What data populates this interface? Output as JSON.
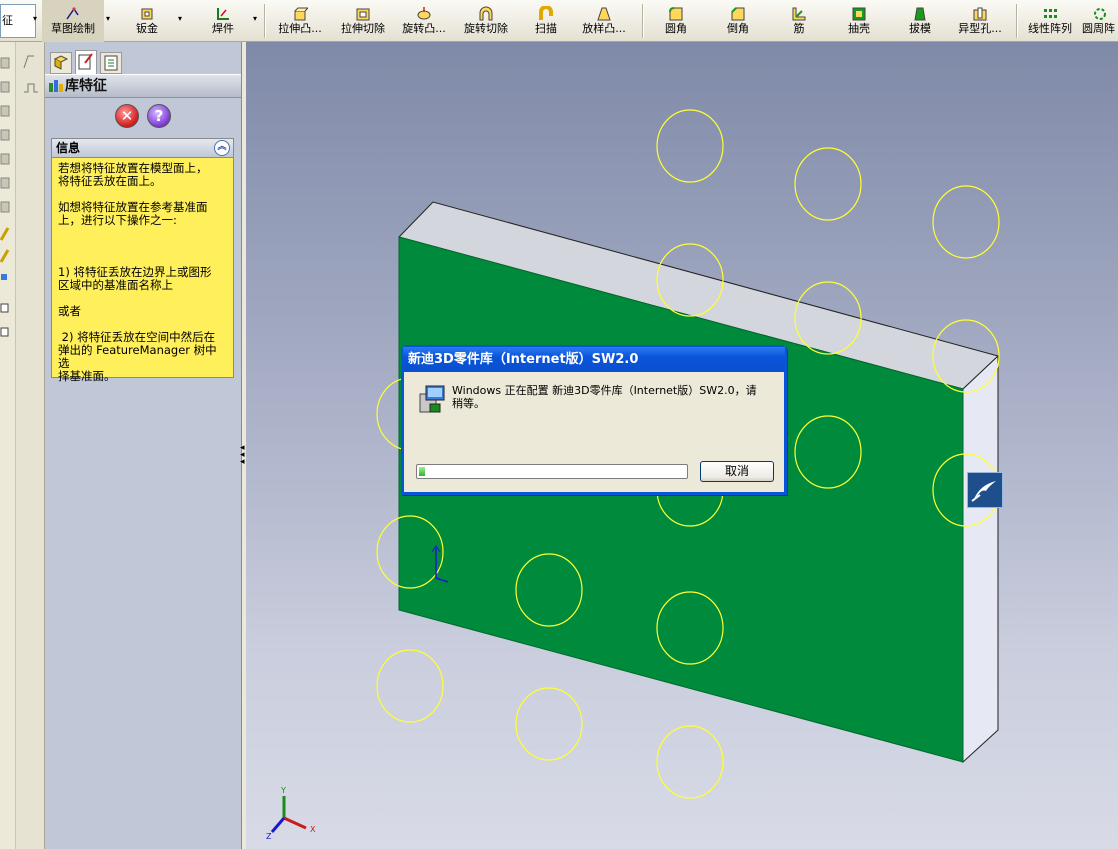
{
  "toolbar": {
    "items": [
      {
        "label": "征",
        "icon": "feature-icon"
      },
      {
        "label": "草图绘制",
        "icon": "sketch-icon"
      },
      {
        "label": "钣金",
        "icon": "sheetmetal-icon"
      },
      {
        "label": "焊件",
        "icon": "weldment-icon"
      },
      {
        "label": "拉伸凸...",
        "icon": "extrude-boss-icon"
      },
      {
        "label": "拉伸切除",
        "icon": "extrude-cut-icon"
      },
      {
        "label": "旋转凸...",
        "icon": "revolve-boss-icon"
      },
      {
        "label": "旋转切除",
        "icon": "revolve-cut-icon"
      },
      {
        "label": "扫描",
        "icon": "sweep-icon"
      },
      {
        "label": "放样凸...",
        "icon": "loft-icon"
      },
      {
        "label": "圆角",
        "icon": "fillet-icon"
      },
      {
        "label": "倒角",
        "icon": "chamfer-icon"
      },
      {
        "label": "筋",
        "icon": "rib-icon"
      },
      {
        "label": "抽壳",
        "icon": "shell-icon"
      },
      {
        "label": "拔模",
        "icon": "draft-icon"
      },
      {
        "label": "异型孔...",
        "icon": "hole-wizard-icon"
      },
      {
        "label": "线性阵列",
        "icon": "linear-pattern-icon"
      },
      {
        "label": "圆周阵",
        "icon": "circular-pattern-icon"
      }
    ]
  },
  "property_manager": {
    "title": "库特征",
    "info_header": "信息",
    "info_text": "若想将特征放置在模型面上，\n将特征丢放在面上。\n\n如想将特征放置在参考基准面\n上，进行以下操作之一:\n\n\n\n1) 将特征丢放在边界上或图形\n区域中的基准面名称上\n\n或者\n\n 2) 将特征丢放在空间中然后在\n弹出的 FeatureManager 树中选\n择基准面。"
  },
  "dialog": {
    "title": "新迪3D零件库（Internet版）SW2.0",
    "message": "Windows 正在配置 新迪3D零件库（Internet版）SW2.0，请\n稍等。",
    "progress": 0.02,
    "cancel_label": "取消"
  },
  "triad": {
    "x": "X",
    "y": "Y",
    "z": "Z"
  },
  "colors": {
    "face": "#008a3c",
    "sketch": "#ffff33",
    "title_bar": "#0a54d9"
  }
}
